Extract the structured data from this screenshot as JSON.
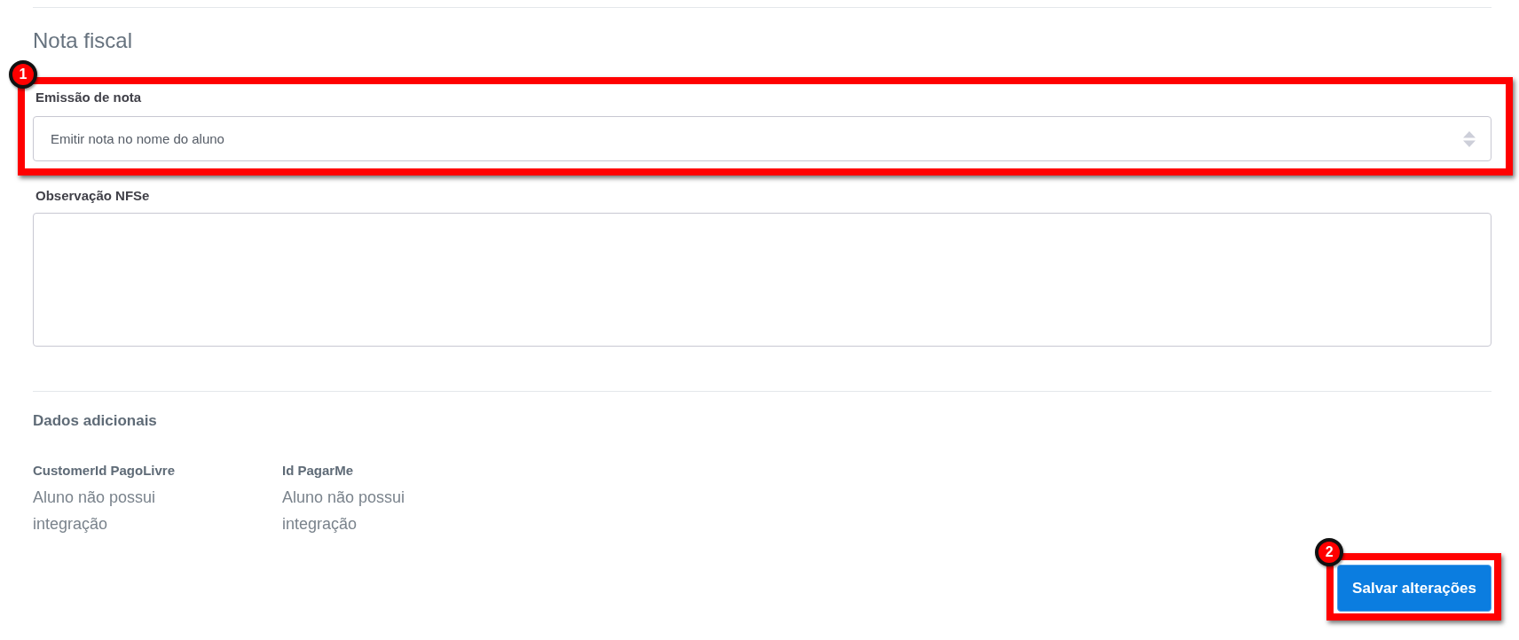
{
  "nota_fiscal": {
    "title": "Nota fiscal",
    "fields": [
      {
        "kind": "select",
        "label": "Emissão de nota",
        "value": "Emitir nota no nome do aluno",
        "callout": "1"
      },
      {
        "kind": "textarea",
        "label": "Observação NFSe"
      }
    ]
  },
  "dados_adicionais": {
    "title": "Dados adicionais",
    "items": [
      {
        "label": "CustomerId PagoLivre",
        "value": "Aluno não possui integração"
      },
      {
        "label": "Id PagarMe",
        "value": "Aluno não possui integração"
      }
    ]
  },
  "save_button": {
    "label": "Salvar alterações",
    "callout": "2"
  }
}
